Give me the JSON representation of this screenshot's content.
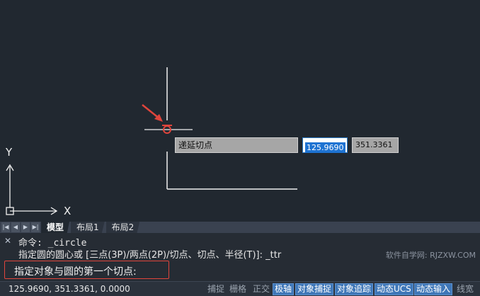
{
  "canvas": {
    "tooltip_label": "递延切点",
    "coord_x": "125.9690",
    "coord_y": "351.3361",
    "ucs_y": "Y",
    "ucs_x": "X"
  },
  "tabs": {
    "nav_icons": [
      "first-icon",
      "prev-icon",
      "next-icon",
      "last-icon"
    ],
    "items": [
      {
        "label": "模型",
        "active": true
      },
      {
        "label": "布局1",
        "active": false
      },
      {
        "label": "布局2",
        "active": false
      }
    ]
  },
  "command": {
    "line1": "命令: _circle",
    "line2": "指定圆的圆心或 [三点(3P)/两点(2P)/切点、切点、半径(T)]: _ttr",
    "watermark": "软件自学网: RJZXW.COM",
    "prompt": "指定对象与圆的第一个切点:"
  },
  "status": {
    "coords": "125.9690, 351.3361, 0.0000",
    "buttons": [
      {
        "label": "捕捉",
        "on": false
      },
      {
        "label": "栅格",
        "on": false
      },
      {
        "label": "正交",
        "on": false
      },
      {
        "label": "极轴",
        "on": true
      },
      {
        "label": "对象捕捉",
        "on": true
      },
      {
        "label": "对象追踪",
        "on": true
      },
      {
        "label": "动态UCS",
        "on": true
      },
      {
        "label": "动态输入",
        "on": true
      },
      {
        "label": "线宽",
        "on": false
      }
    ]
  },
  "colors": {
    "canvas_bg": "#212830",
    "accent_red": "#e0453c",
    "status_on": "#3f77b8"
  }
}
